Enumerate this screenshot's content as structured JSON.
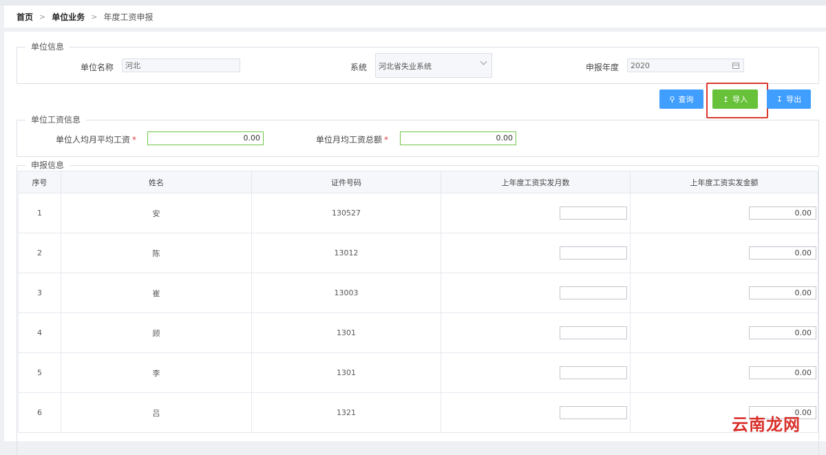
{
  "breadcrumb": {
    "home": "首页",
    "section": "单位业务",
    "current": "年度工资申报",
    "sep": ">"
  },
  "unit_info": {
    "legend": "单位信息",
    "unit_name_label": "单位名称",
    "unit_name_value": "河北",
    "system_label": "系统",
    "system_value": "河北省失业系统",
    "year_label": "申报年度",
    "year_value": "2020"
  },
  "buttons": {
    "query": "查询",
    "import": "导入",
    "export": "导出"
  },
  "wage_info": {
    "legend": "单位工资信息",
    "avg_wage_label": "单位人均月平均工资",
    "avg_wage_value": "0.00",
    "total_wage_label": "单位月均工资总额",
    "total_wage_value": "0.00",
    "required_mark": "*"
  },
  "report_info": {
    "legend": "申报信息",
    "columns": [
      "序号",
      "姓名",
      "证件号码",
      "上年度工资实发月数",
      "上年度工资实发金额"
    ],
    "rows": [
      {
        "no": "1",
        "name": "安",
        "id": "130527",
        "months": "",
        "amount": "0.00"
      },
      {
        "no": "2",
        "name": "陈",
        "id": "13012",
        "months": "",
        "amount": "0.00"
      },
      {
        "no": "3",
        "name": "崔",
        "id": "13003",
        "months": "",
        "amount": "0.00"
      },
      {
        "no": "4",
        "name": "顾",
        "id": "1301",
        "months": "",
        "amount": "0.00"
      },
      {
        "no": "5",
        "name": "李",
        "id": "1301",
        "months": "",
        "amount": "0.00"
      },
      {
        "no": "6",
        "name": "吕",
        "id": "1321",
        "months": "",
        "amount": "0.00"
      }
    ]
  },
  "watermark": "云南龙网",
  "colors": {
    "primary": "#409eff",
    "success": "#67c23a",
    "highlight": "#d9362b"
  }
}
